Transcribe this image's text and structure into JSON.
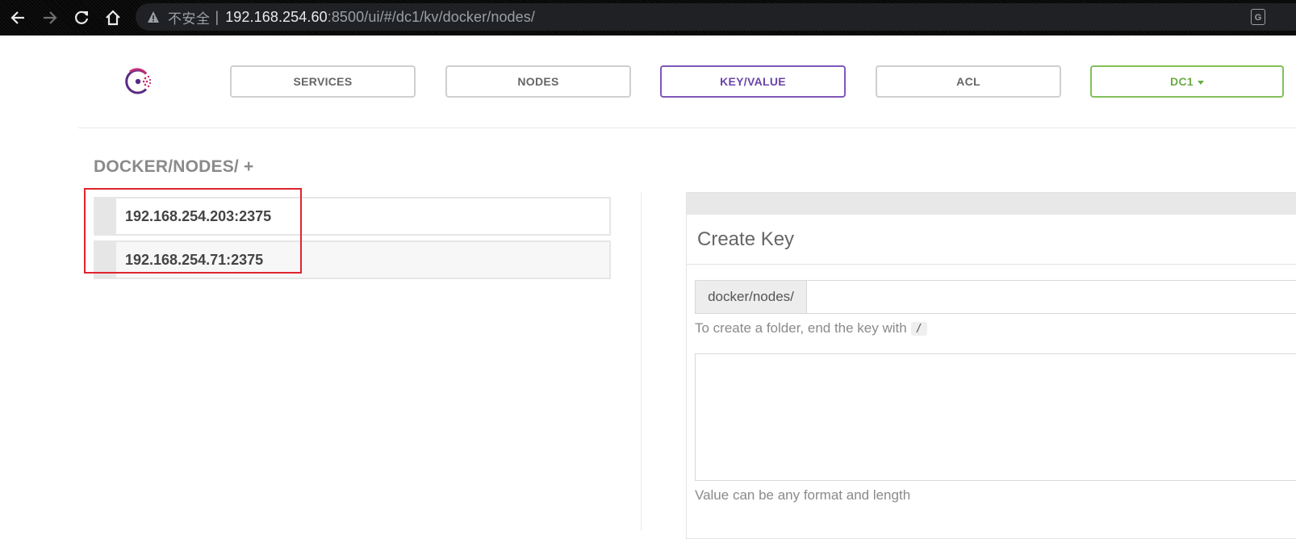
{
  "browser": {
    "security_label": "不安全",
    "separator": "|",
    "url_host": "192.168.254.60",
    "url_rest": ":8500/ui/#/dc1/kv/docker/nodes/",
    "translate_icon_text": "G"
  },
  "nav": {
    "services": "SERVICES",
    "nodes": "NODES",
    "key_value": "KEY/VALUE",
    "acl": "ACL",
    "datacenter": "DC1",
    "active": "KEY/VALUE"
  },
  "breadcrumb": {
    "path": "DOCKER/NODES/",
    "add": "+"
  },
  "keys": [
    {
      "label": "192.168.254.203:2375"
    },
    {
      "label": "192.168.254.71:2375"
    }
  ],
  "create_key": {
    "title": "Create Key",
    "prefix": "docker/nodes/",
    "key_value": "",
    "folder_help": "To create a folder, end the key with",
    "folder_char": "/",
    "value": "",
    "value_help": "Value can be any format and length"
  },
  "colors": {
    "accent_purple": "#7f57ba",
    "dc_green": "#82bf5b",
    "highlight_red": "#e0242c",
    "logo_red": "#c62a71"
  },
  "icons": [
    "back-arrow-icon",
    "forward-arrow-icon",
    "reload-icon",
    "home-icon",
    "warning-triangle-icon",
    "translate-icon",
    "consul-logo-icon",
    "caret-down-icon"
  ]
}
